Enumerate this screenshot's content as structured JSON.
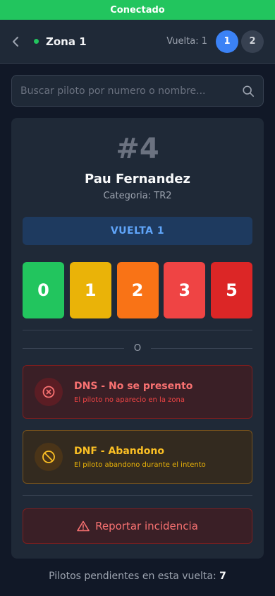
{
  "status": {
    "text": "Conectado",
    "color": "#22c55e"
  },
  "header": {
    "zone": "Zona 1",
    "lap_label": "Vuelta: 1",
    "laps": [
      "1",
      "2"
    ],
    "active_lap": "1"
  },
  "search": {
    "placeholder": "Buscar piloto por numero o nombre..."
  },
  "pilot": {
    "number": "#4",
    "name": "Pau Fernandez",
    "category": "Categoria: TR2"
  },
  "lap_banner": "VUELTA 1",
  "scores": [
    {
      "label": "0",
      "color": "#22c55e"
    },
    {
      "label": "1",
      "color": "#eab308"
    },
    {
      "label": "2",
      "color": "#f97316"
    },
    {
      "label": "3",
      "color": "#ef4444"
    },
    {
      "label": "5",
      "color": "#dc2626"
    }
  ],
  "divider_text": "O",
  "dns": {
    "title": "DNS - No se presento",
    "subtitle": "El piloto no aparecio en la zona",
    "icon": "x-circle-icon"
  },
  "dnf": {
    "title": "DNF - Abandono",
    "subtitle": "El piloto abandono durante el intento",
    "icon": "ban-icon"
  },
  "report_button": {
    "label": "Reportar incidencia",
    "icon": "warning-triangle-icon"
  },
  "footer": {
    "label": "Pilotos pendientes en esta vuelta:",
    "count": "7"
  }
}
